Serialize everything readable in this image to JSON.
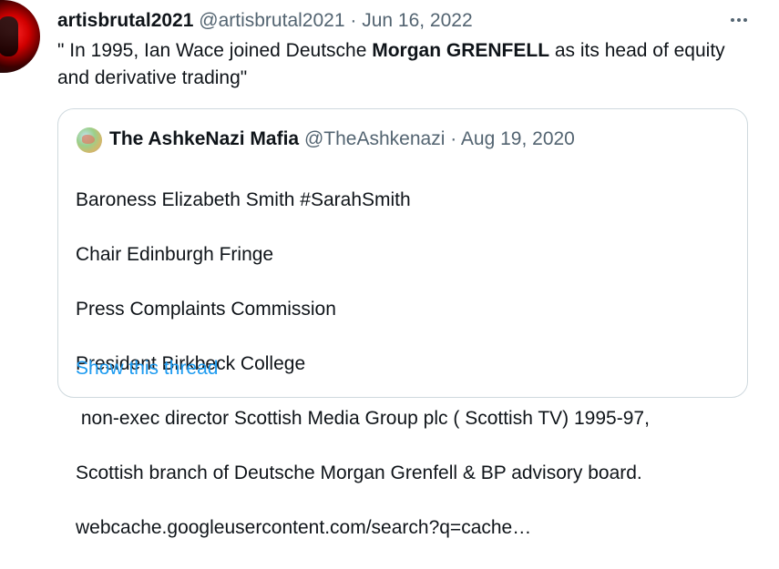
{
  "tweet": {
    "display_name": "artisbrutal2021",
    "handle": "@artisbrutal2021",
    "separator": "·",
    "date": "Jun 16, 2022",
    "text_part1": "\" In 1995, Ian Wace joined Deutsche ",
    "text_bold": "Morgan GRENFELL",
    "text_part2": " as its head of equity and derivative trading\"",
    "more_icon": "more-horizontal-icon"
  },
  "quote": {
    "display_name": "The AshkeNazi Mafia",
    "handle": "@TheAshkenazi",
    "separator": "·",
    "date": "Aug 19, 2020",
    "lines": [
      "Baroness Elizabeth Smith #SarahSmith",
      "Chair Edinburgh Fringe",
      "Press Complaints Commission",
      "President Birkbeck College",
      " non-exec director Scottish Media Group plc ( Scottish TV) 1995-97,",
      "Scottish branch of Deutsche Morgan Grenfell & BP advisory board.",
      "webcache.googleusercontent.com/search?q=cache…"
    ],
    "show_thread_label": "Show this thread"
  },
  "colors": {
    "text_primary": "#0f1419",
    "text_secondary": "#536471",
    "link": "#1d9bf0",
    "border": "#cfd9de"
  }
}
